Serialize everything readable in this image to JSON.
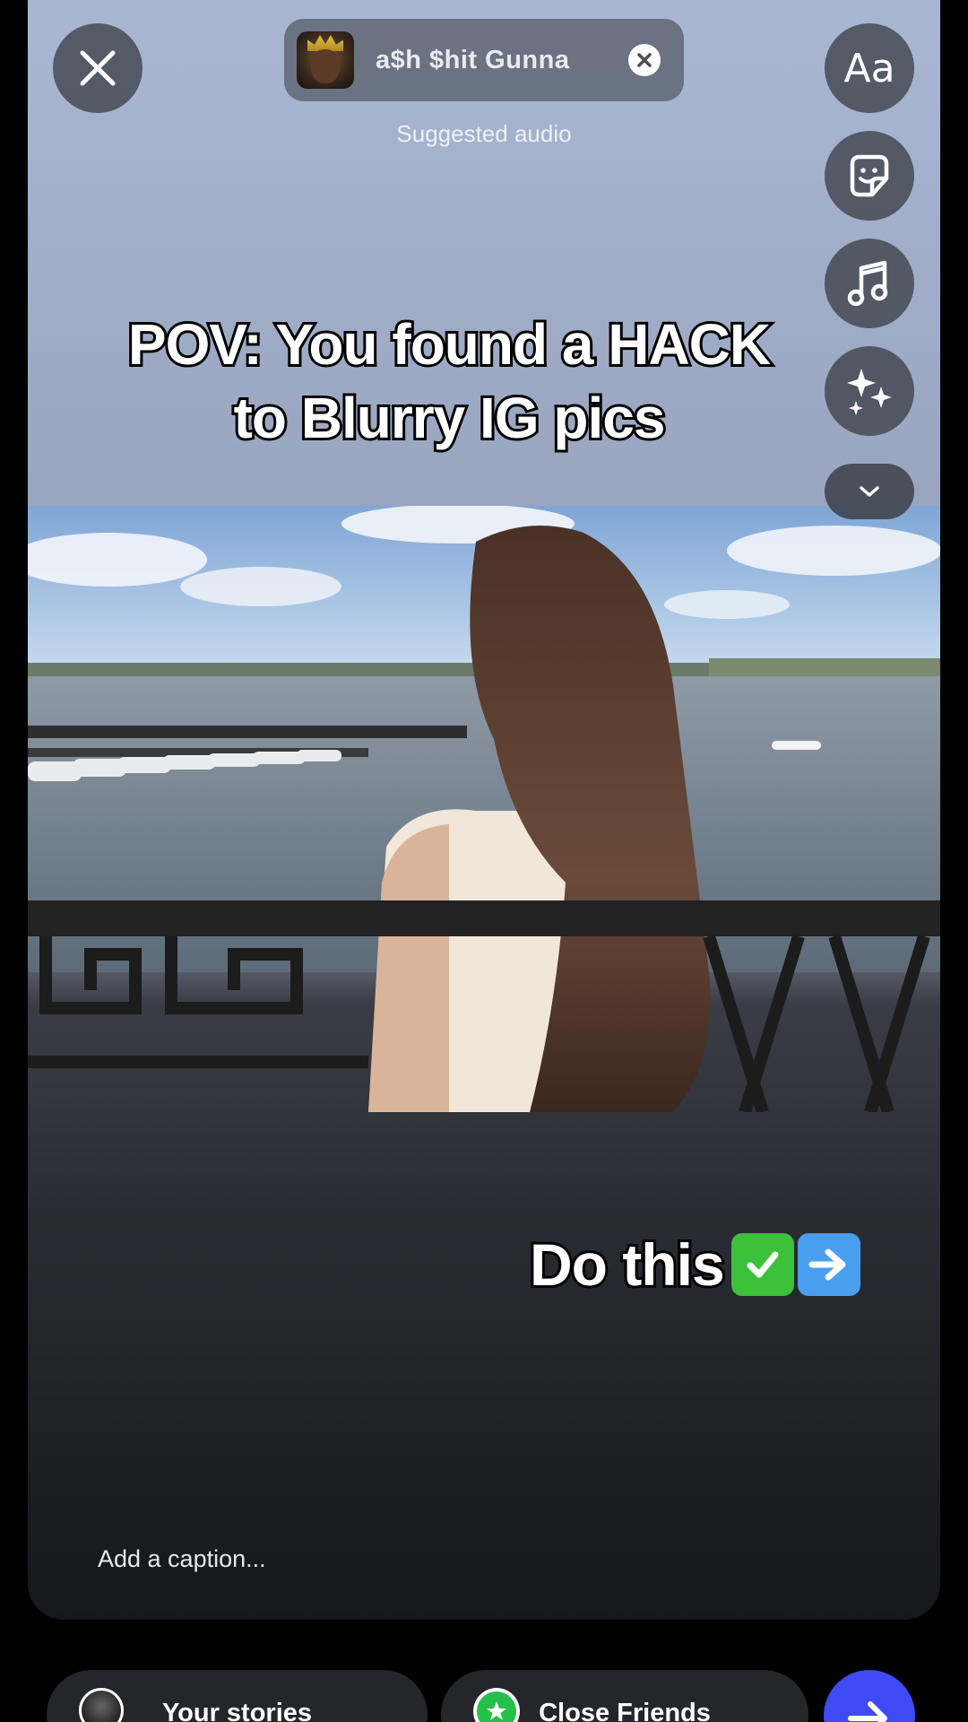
{
  "audio": {
    "track_text": "a$h $hit   Gunna",
    "suggested_label": "Suggested audio"
  },
  "tools": {
    "text_tool_label": "Aa",
    "sticker_icon": "sticker-icon",
    "music_icon": "music-note-icon",
    "effects_icon": "sparkles-icon",
    "collapse_icon": "chevron-down-icon"
  },
  "overlay": {
    "pov_line1": "POV: You found a HACK",
    "pov_line2": "to Blurry IG pics",
    "do_this": "Do this",
    "emoji_check": "✓",
    "emoji_arrow": "→"
  },
  "caption": {
    "placeholder": "Add a caption..."
  },
  "share": {
    "your_stories_label": "Your stories",
    "close_friends_label": "Close Friends"
  },
  "colors": {
    "accent_blue": "#3e4bf5",
    "close_friends_green": "#25c04a",
    "pill_bg": "#24262b"
  }
}
